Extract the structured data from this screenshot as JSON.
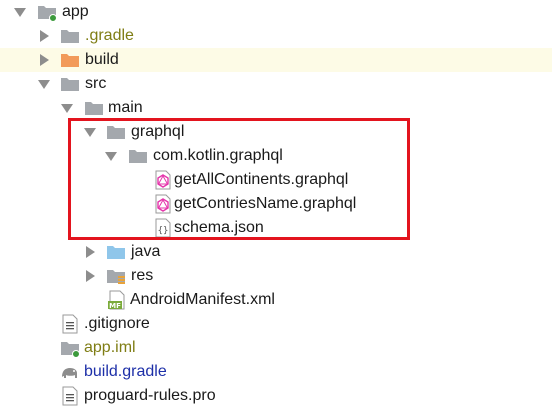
{
  "tree": {
    "app": "app",
    "gradle_dir": ".gradle",
    "build_dir": "build",
    "src": "src",
    "main": "main",
    "graphql": "graphql",
    "package": "com.kotlin.graphql",
    "file_continents": "getAllContinents.graphql",
    "file_countries": "getContriesName.graphql",
    "file_schema": "schema.json",
    "java": "java",
    "res": "res",
    "manifest": "AndroidManifest.xml",
    "gitignore": ".gitignore",
    "iml": "app.iml",
    "build_gradle": "build.gradle",
    "proguard": "proguard-rules.pro"
  },
  "icons": {
    "folder": "folder-icon",
    "module": "module-folder-icon",
    "excluded": "excluded-folder-icon",
    "source": "source-folder-icon",
    "resources": "resources-folder-icon",
    "graphql_file": "graphql-file-icon",
    "json_file": "json-file-icon",
    "manifest": "manifest-file-icon",
    "text_file": "text-file-icon",
    "gradle": "gradle-elephant-icon"
  },
  "colors": {
    "folder": "#a4a8ad",
    "excluded_folder": "#f29a5a",
    "source_folder": "#8fc6ea",
    "graphql": "#e535ab",
    "highlight_row": "#fdfbe6",
    "selection_box": "#e3141e"
  }
}
